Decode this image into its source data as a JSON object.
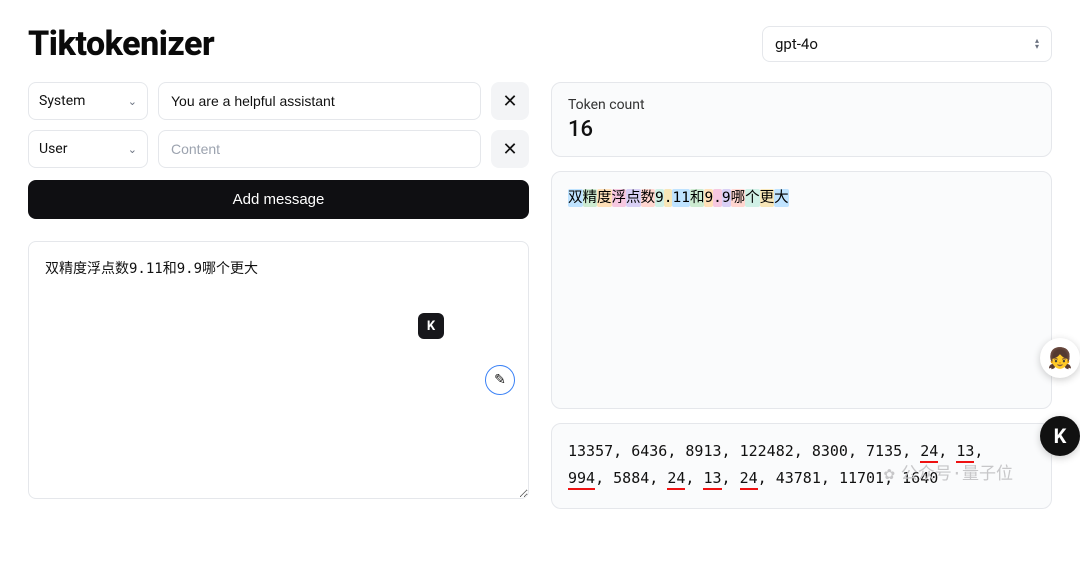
{
  "header": {
    "title": "Tiktokenizer",
    "model": "gpt-4o"
  },
  "messages": [
    {
      "role": "System",
      "content": "You are a helpful assistant"
    },
    {
      "role": "User",
      "content": "",
      "placeholder": "Content"
    }
  ],
  "add_button_label": "Add message",
  "raw_text": "双精度浮点数9.11和9.9哪个更大",
  "token_panel": {
    "label": "Token count",
    "count": "16"
  },
  "viz_tokens": [
    {
      "t": "双",
      "c": "c1"
    },
    {
      "t": "精",
      "c": "c2"
    },
    {
      "t": "度",
      "c": "c3"
    },
    {
      "t": "浮",
      "c": "c4"
    },
    {
      "t": "点",
      "c": "c5"
    },
    {
      "t": "数",
      "c": "c6"
    },
    {
      "t": "9",
      "c": "c7"
    },
    {
      "t": ".",
      "c": "c8"
    },
    {
      "t": "11",
      "c": "c1"
    },
    {
      "t": "和",
      "c": "c2"
    },
    {
      "t": "9",
      "c": "c3"
    },
    {
      "t": ".",
      "c": "c4"
    },
    {
      "t": "9",
      "c": "c5"
    },
    {
      "t": "哪",
      "c": "c6"
    },
    {
      "t": "个",
      "c": "c7"
    },
    {
      "t": "更",
      "c": "c8"
    },
    {
      "t": "大",
      "c": "c1"
    }
  ],
  "token_ids": [
    {
      "v": "13357"
    },
    {
      "v": "6436"
    },
    {
      "v": "8913"
    },
    {
      "v": "122482"
    },
    {
      "v": "8300"
    },
    {
      "v": "7135"
    },
    {
      "v": "24",
      "u": true
    },
    {
      "v": "13",
      "u": true
    },
    {
      "v": "994",
      "u": true
    },
    {
      "v": "5884"
    },
    {
      "v": "24",
      "u": true
    },
    {
      "v": "13",
      "u": true
    },
    {
      "v": "24",
      "u": true
    },
    {
      "v": "43781"
    },
    {
      "v": "11701"
    },
    {
      "v": "1640"
    }
  ],
  "floats": {
    "badge_label": "K",
    "avatar_emoji": "👧"
  },
  "watermark": {
    "icon": "✿",
    "text": "公众号·量子位"
  }
}
